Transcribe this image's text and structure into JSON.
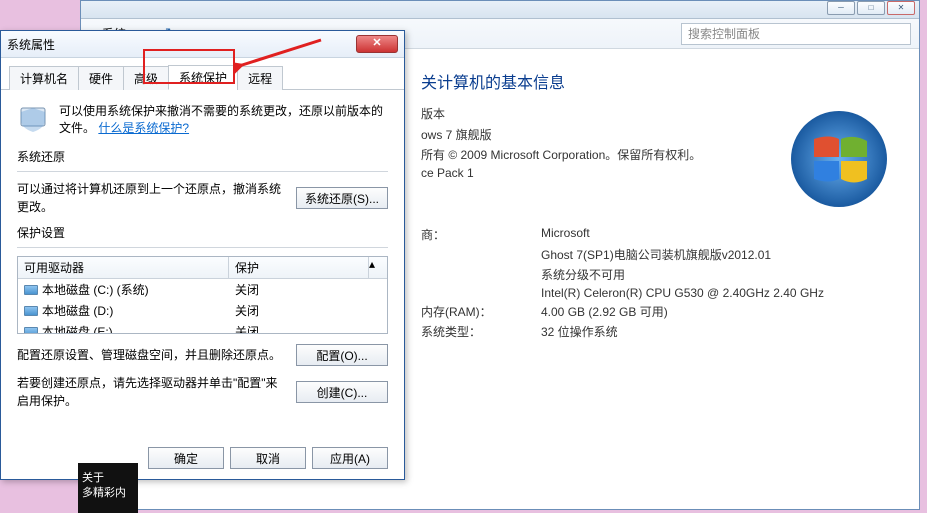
{
  "bg": {
    "breadcrumb_item": "系统",
    "search_placeholder": "搜索控制面板",
    "heading_suffix": "关计算机的基本信息",
    "edition_label": "版本",
    "edition_value": "ows 7 旗舰版",
    "copyright": "所有 © 2009 Microsoft Corporation。保留所有权利。",
    "sp": "ce Pack 1",
    "mfr_k": "商：",
    "mfr_v": "Microsoft",
    "model_v": "Ghost 7(SP1)电脑公司装机旗舰版v2012.01",
    "rating_link": "系统分级不可用",
    "cpu": "Intel(R) Celeron(R) CPU G530 @ 2.40GHz   2.40 GHz",
    "ram_k": "内存(RAM)：",
    "ram_v": "4.00 GB (2.92 GB 可用)",
    "systype_k": "系统类型：",
    "systype_v": "32 位操作系统"
  },
  "dlg": {
    "title": "系统属性",
    "tabs": [
      "计算机名",
      "硬件",
      "高级",
      "系统保护",
      "远程"
    ],
    "intro": "可以使用系统保护来撤消不需要的系统更改，还原以前版本的文件。",
    "intro_link": "什么是系统保护?",
    "restore_group": "系统还原",
    "restore_desc": "可以通过将计算机还原到上一个还原点，撤消系统更改。",
    "restore_btn": "系统还原(S)...",
    "prot_group": "保护设置",
    "drive_head_drive": "可用驱动器",
    "drive_head_prot": "保护",
    "drives": [
      {
        "name": "本地磁盘 (C:) (系统)",
        "prot": "关闭"
      },
      {
        "name": "本地磁盘 (D:)",
        "prot": "关闭"
      },
      {
        "name": "本地磁盘 (E:)",
        "prot": "关闭"
      }
    ],
    "config_desc": "配置还原设置、管理磁盘空间，并且删除还原点。",
    "config_btn": "配置(O)...",
    "create_desc": "若要创建还原点，请先选择驱动器并单击\"配置\"来启用保护。",
    "create_btn": "创建(C)...",
    "ok": "确定",
    "cancel": "取消",
    "apply": "应用(A)"
  },
  "dark": {
    "l1": "关于",
    "l2": "多精彩内"
  }
}
